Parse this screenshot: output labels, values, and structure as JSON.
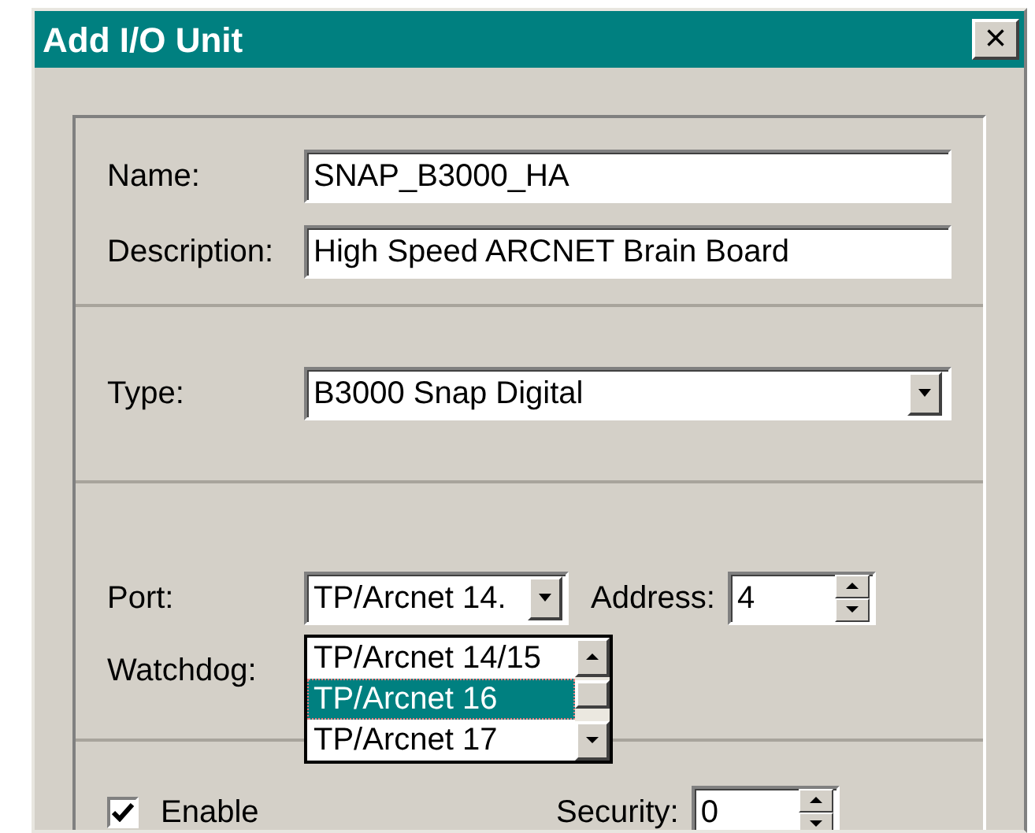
{
  "window": {
    "title": "Add I/O Unit",
    "close": "×"
  },
  "fields": [
    {
      "label": "Name:",
      "value": "SNAP_B3000_HA"
    },
    {
      "label": "Description:",
      "value": "High Speed ARCNET Brain Board"
    }
  ],
  "type": {
    "label": "Type:",
    "value": "B3000 Snap Digital"
  },
  "port": {
    "label": "Port:",
    "value": "TP/Arcnet 14.",
    "expanded": true,
    "options": [
      {
        "label": "TP/Arcnet 14/15",
        "selected": false
      },
      {
        "label": "TP/Arcnet 16",
        "selected": true
      },
      {
        "label": "TP/Arcnet 17",
        "selected": false
      }
    ]
  },
  "address": {
    "label": "Address:",
    "value": "4"
  },
  "watchdog": {
    "label": "Watchdog:"
  },
  "enable": {
    "label": "Enable",
    "checked": true
  },
  "security": {
    "label": "Security:",
    "value": "0"
  }
}
